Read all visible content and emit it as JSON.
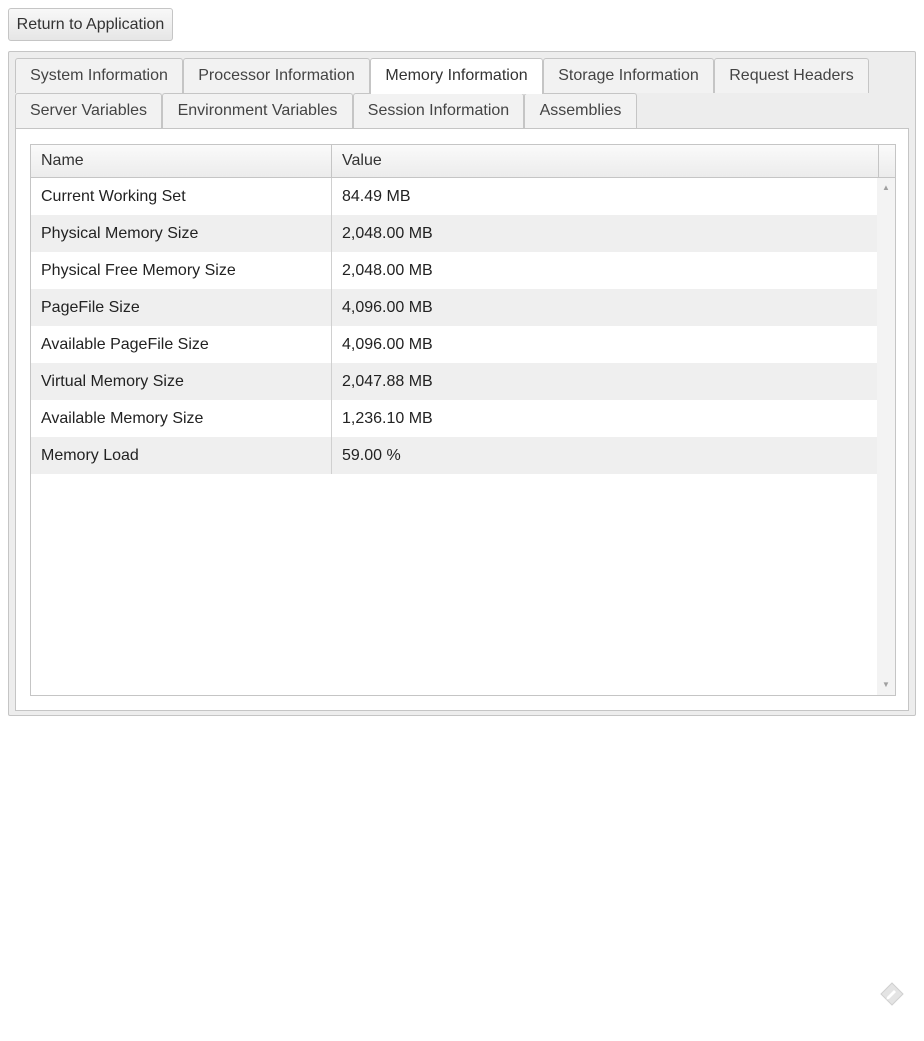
{
  "toolbar": {
    "return_label": "Return to Application"
  },
  "tabs": [
    {
      "label": "System Information",
      "active": false
    },
    {
      "label": "Processor Information",
      "active": false
    },
    {
      "label": "Memory Information",
      "active": true
    },
    {
      "label": "Storage Information",
      "active": false
    },
    {
      "label": "Request Headers",
      "active": false
    },
    {
      "label": "Server Variables",
      "active": false
    },
    {
      "label": "Environment Variables",
      "active": false
    },
    {
      "label": "Session Information",
      "active": false
    },
    {
      "label": "Assemblies",
      "active": false
    }
  ],
  "grid": {
    "columns": [
      "Name",
      "Value"
    ],
    "rows": [
      {
        "name": "Current Working Set",
        "value": "84.49 MB"
      },
      {
        "name": "Physical Memory Size",
        "value": "2,048.00 MB"
      },
      {
        "name": "Physical Free Memory Size",
        "value": "2,048.00 MB"
      },
      {
        "name": "PageFile Size",
        "value": "4,096.00 MB"
      },
      {
        "name": "Available PageFile Size",
        "value": "4,096.00 MB"
      },
      {
        "name": "Virtual Memory Size",
        "value": "2,047.88 MB"
      },
      {
        "name": "Available Memory Size",
        "value": "1,236.10 MB"
      },
      {
        "name": "Memory Load",
        "value": "59.00 %"
      }
    ]
  },
  "icons": {
    "scroll_up": "scroll-up-arrow-icon",
    "scroll_down": "scroll-down-arrow-icon",
    "corner": "edit-pencil-icon"
  }
}
